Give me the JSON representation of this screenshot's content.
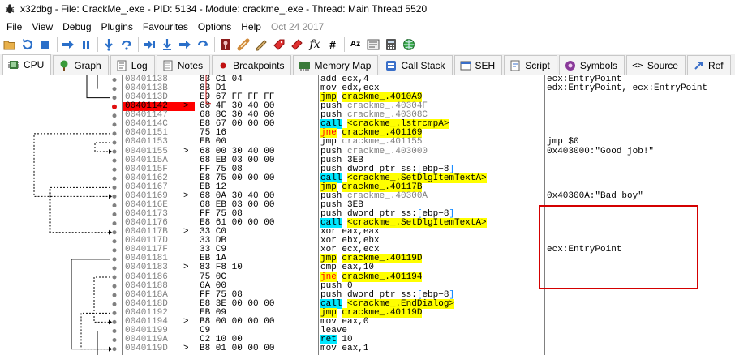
{
  "window": {
    "title": "x32dbg - File: CrackMe_.exe - PID: 5134 - Module: crackme_.exe - Thread: Main Thread 5520"
  },
  "menu": {
    "items": [
      "File",
      "View",
      "Debug",
      "Plugins",
      "Favourites",
      "Options",
      "Help"
    ],
    "date": "Oct 24 2017"
  },
  "toolbar": {
    "icons": [
      "open-folder-icon",
      "restart-icon",
      "stop-icon",
      "run-icon",
      "pause-icon",
      "step-into-icon",
      "step-over-icon",
      "trace-into-icon",
      "trace-over-icon",
      "execute-till-return-icon",
      "run-to-user-code-icon",
      "scylla-icon",
      "patch-icon",
      "comments-icon",
      "labels-icon",
      "bookmarks-icon",
      "functions-icon",
      "hash-icon",
      "font-icon",
      "strings-icon",
      "calculator-icon",
      "globe-icon"
    ],
    "fx_label": "fx",
    "hash_label": "#",
    "az_label": "Aᴢ"
  },
  "tabs": [
    {
      "label": "CPU",
      "icon": "cpu-icon",
      "active": true
    },
    {
      "label": "Graph",
      "icon": "graph-icon"
    },
    {
      "label": "Log",
      "icon": "log-icon"
    },
    {
      "label": "Notes",
      "icon": "notes-icon"
    },
    {
      "label": "Breakpoints",
      "icon": "breakpoint-dot-icon"
    },
    {
      "label": "Memory Map",
      "icon": "memory-map-icon"
    },
    {
      "label": "Call Stack",
      "icon": "call-stack-icon"
    },
    {
      "label": "SEH",
      "icon": "seh-icon"
    },
    {
      "label": "Script",
      "icon": "script-icon"
    },
    {
      "label": "Symbols",
      "icon": "symbols-icon"
    },
    {
      "label": "Source",
      "icon": "source-icon"
    },
    {
      "label": "Ref",
      "icon": "references-icon"
    }
  ],
  "disasm": {
    "rows": [
      {
        "addr": "00401138",
        "mark": "",
        "bytes": "83 C1 04",
        "mn": "add",
        "ops": "ecx,4",
        "kind": "plain",
        "comment": "ecx:EntryPoint"
      },
      {
        "addr": "0040113B",
        "mark": "",
        "bytes": "8B D1",
        "mn": "mov",
        "ops": "edx,ecx",
        "kind": "plain",
        "comment": "edx:EntryPoint, ecx:EntryPoint"
      },
      {
        "addr": "0040113D",
        "mark": "",
        "bytes": "E9 67 FF FF FF",
        "mn": "jmp",
        "ops": "crackme_.4010A9",
        "kind": "jmp",
        "comment": ""
      },
      {
        "addr": "00401142",
        "mark": ">",
        "bytes": "68 4F 30 40 00",
        "mn": "push",
        "ops": "crackme_.40304F",
        "kind": "push",
        "comment": "",
        "eip": true
      },
      {
        "addr": "00401147",
        "mark": "",
        "bytes": "68 8C 30 40 00",
        "mn": "push",
        "ops": "crackme_.40308C",
        "kind": "push",
        "comment": ""
      },
      {
        "addr": "0040114C",
        "mark": "",
        "bytes": "E8 67 00 00 00",
        "mn": "call",
        "ops": "<crackme_.lstrcmpA>",
        "kind": "call",
        "comment": ""
      },
      {
        "addr": "00401151",
        "mark": "",
        "bytes": "75 16",
        "mn": "jne",
        "ops": "crackme_.401169",
        "kind": "jcc",
        "comment": ""
      },
      {
        "addr": "00401153",
        "mark": "",
        "bytes": "EB 00",
        "mn": "jmp",
        "ops": "crackme_.401155",
        "kind": "jmpgrey",
        "comment": "jmp $0"
      },
      {
        "addr": "00401155",
        "mark": ">",
        "bytes": "68 00 30 40 00",
        "mn": "push",
        "ops": "crackme_.403000",
        "kind": "push",
        "comment": "0x403000:\"Good job!\""
      },
      {
        "addr": "0040115A",
        "mark": "",
        "bytes": "68 EB 03 00 00",
        "mn": "push",
        "ops": "3EB",
        "kind": "plain",
        "comment": ""
      },
      {
        "addr": "0040115F",
        "mark": "",
        "bytes": "FF 75 08",
        "mn": "push",
        "ops": "dword ptr ss:[ebp+8]",
        "kind": "mem",
        "comment": ""
      },
      {
        "addr": "00401162",
        "mark": "",
        "bytes": "E8 75 00 00 00",
        "mn": "call",
        "ops": "<crackme_.SetDlgItemTextA>",
        "kind": "call",
        "comment": ""
      },
      {
        "addr": "00401167",
        "mark": "",
        "bytes": "EB 12",
        "mn": "jmp",
        "ops": "crackme_.40117B",
        "kind": "jmp",
        "comment": ""
      },
      {
        "addr": "00401169",
        "mark": ">",
        "bytes": "68 0A 30 40 00",
        "mn": "push",
        "ops": "crackme_.40300A",
        "kind": "push",
        "comment": "0x40300A:\"Bad boy\""
      },
      {
        "addr": "0040116E",
        "mark": "",
        "bytes": "68 EB 03 00 00",
        "mn": "push",
        "ops": "3EB",
        "kind": "plain",
        "comment": ""
      },
      {
        "addr": "00401173",
        "mark": "",
        "bytes": "FF 75 08",
        "mn": "push",
        "ops": "dword ptr ss:[ebp+8]",
        "kind": "mem",
        "comment": ""
      },
      {
        "addr": "00401176",
        "mark": "",
        "bytes": "E8 61 00 00 00",
        "mn": "call",
        "ops": "<crackme_.SetDlgItemTextA>",
        "kind": "call",
        "comment": ""
      },
      {
        "addr": "0040117B",
        "mark": ">",
        "bytes": "33 C0",
        "mn": "xor",
        "ops": "eax,eax",
        "kind": "plain",
        "comment": ""
      },
      {
        "addr": "0040117D",
        "mark": "",
        "bytes": "33 DB",
        "mn": "xor",
        "ops": "ebx,ebx",
        "kind": "plain",
        "comment": ""
      },
      {
        "addr": "0040117F",
        "mark": "",
        "bytes": "33 C9",
        "mn": "xor",
        "ops": "ecx,ecx",
        "kind": "plain",
        "comment": "ecx:EntryPoint"
      },
      {
        "addr": "00401181",
        "mark": "",
        "bytes": "EB 1A",
        "mn": "jmp",
        "ops": "crackme_.40119D",
        "kind": "jmp",
        "comment": ""
      },
      {
        "addr": "00401183",
        "mark": ">",
        "bytes": "83 F8 10",
        "mn": "cmp",
        "ops": "eax,10",
        "kind": "plain",
        "comment": ""
      },
      {
        "addr": "00401186",
        "mark": "",
        "bytes": "75 0C",
        "mn": "jne",
        "ops": "crackme_.401194",
        "kind": "jcc",
        "comment": ""
      },
      {
        "addr": "00401188",
        "mark": "",
        "bytes": "6A 00",
        "mn": "push",
        "ops": "0",
        "kind": "plain",
        "comment": ""
      },
      {
        "addr": "0040118A",
        "mark": "",
        "bytes": "FF 75 08",
        "mn": "push",
        "ops": "dword ptr ss:[ebp+8]",
        "kind": "mem",
        "comment": ""
      },
      {
        "addr": "0040118D",
        "mark": "",
        "bytes": "E8 3E 00 00 00",
        "mn": "call",
        "ops": "<crackme_.EndDialog>",
        "kind": "call",
        "comment": ""
      },
      {
        "addr": "00401192",
        "mark": "",
        "bytes": "EB 09",
        "mn": "jmp",
        "ops": "crackme_.40119D",
        "kind": "jmp",
        "comment": ""
      },
      {
        "addr": "00401194",
        "mark": ">",
        "bytes": "B8 00 00 00 00",
        "mn": "mov",
        "ops": "eax,0",
        "kind": "plain",
        "comment": ""
      },
      {
        "addr": "00401199",
        "mark": "",
        "bytes": "C9",
        "mn": "leave",
        "ops": "",
        "kind": "plain",
        "comment": ""
      },
      {
        "addr": "0040119A",
        "mark": "",
        "bytes": "C2 10 00",
        "mn": "ret",
        "ops": "10",
        "kind": "ret",
        "comment": ""
      },
      {
        "addr": "0040119D",
        "mark": ">",
        "bytes": "B8 01 00 00 00",
        "mn": "mov",
        "ops": "eax,1",
        "kind": "plain",
        "comment": ""
      }
    ]
  }
}
